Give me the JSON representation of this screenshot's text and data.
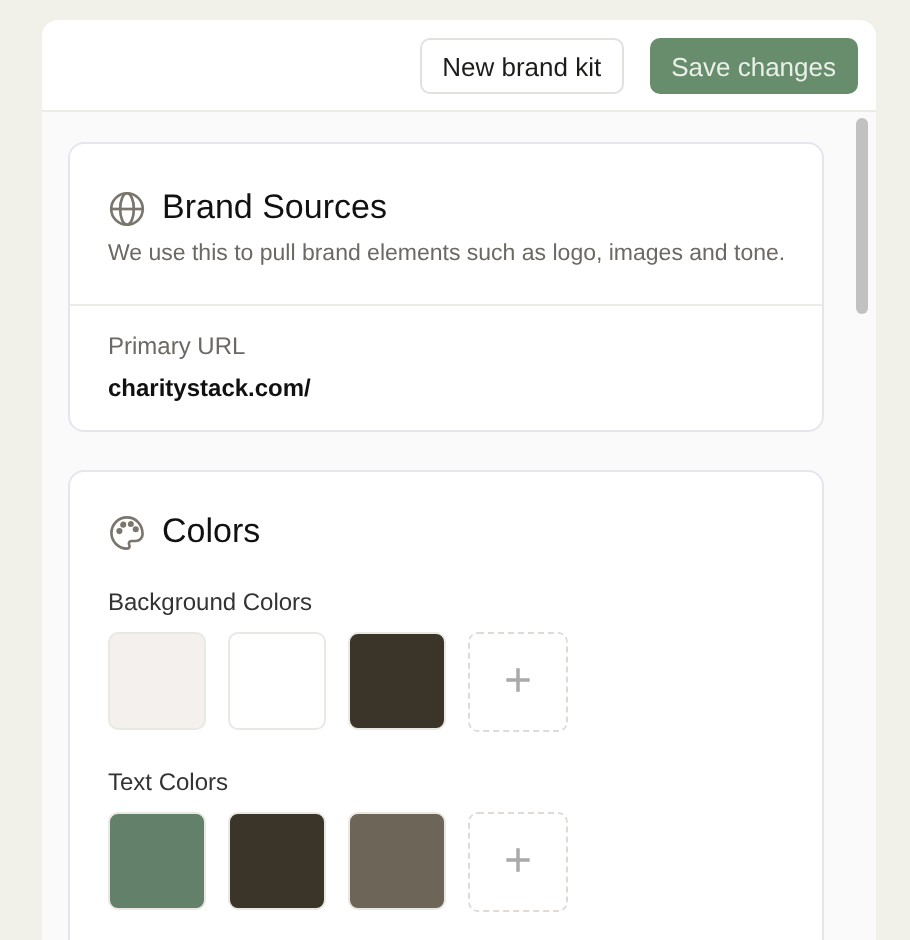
{
  "header": {
    "buttons": [
      {
        "label": "New brand kit",
        "kind": "secondary"
      },
      {
        "label": "Save changes",
        "kind": "primary"
      }
    ]
  },
  "brand_sources": {
    "title": "Brand Sources",
    "description": "We use this to pull brand elements such as logo, images and tone.",
    "field_label": "Primary URL",
    "field_value": "charitystack.com/"
  },
  "colors": {
    "title": "Colors",
    "groups": [
      {
        "label": "Background Colors",
        "swatches": [
          {
            "color": "#f3f0ed"
          },
          {
            "color": "#ffffff"
          },
          {
            "color": "#3b3428"
          }
        ],
        "add_label": "+"
      },
      {
        "label": "Text Colors",
        "swatches": [
          {
            "color": "#62806a"
          },
          {
            "color": "#3b3428"
          },
          {
            "color": "#6d6558"
          }
        ],
        "add_label": "+"
      }
    ]
  }
}
